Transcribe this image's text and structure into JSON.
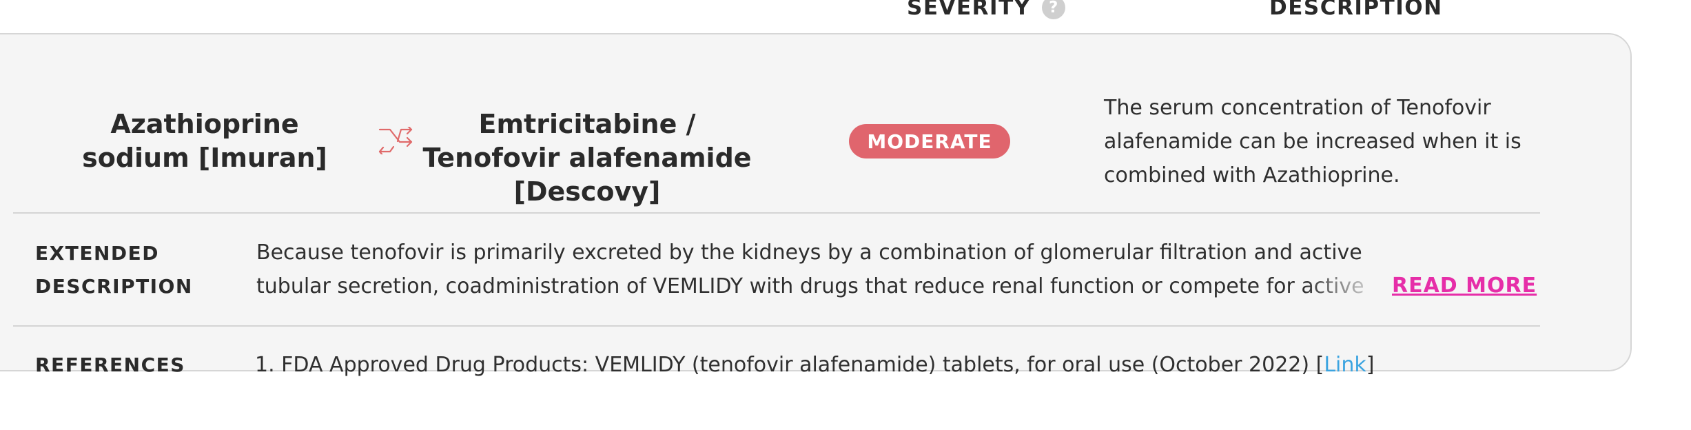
{
  "table_header": {
    "severity_label": "SEVERITY",
    "severity_help_icon": "?",
    "description_label": "DESCRIPTION"
  },
  "interaction": {
    "drug_a": "Azathioprine sodium [Imuran]",
    "swap_icon": "swap-arrows-icon",
    "drug_b": "Emtricitabine / Tenofovir alafenamide [Descovy]",
    "severity": "MODERATE",
    "description": "The serum concentration of Tenofovir alafenamide can be increased when it is combined with Azathioprine."
  },
  "extended_description": {
    "label": "EXTENDED DESCRIPTION",
    "text": "Because tenofovir is primarily excreted by the kidneys by a combination of glomerular filtration and active tubular secretion, coadministration of VEMLIDY with drugs that reduce renal function or compete for active tubular secretion may increase concentrations of tenofovir and other renally eliminated drugs.",
    "read_more_label": "READ MORE"
  },
  "references": {
    "label": "REFERENCES",
    "items": [
      {
        "text": "1. FDA Approved Drug Products: VEMLIDY (tenofovir alafenamide) tablets, for oral use (October 2022) [",
        "link_label": "Link",
        "suffix": "]"
      }
    ]
  },
  "colors": {
    "severity_badge": "#e0656d",
    "read_more": "#e62ea8",
    "link": "#3ba4e0",
    "swap_icon": "#e06a6a",
    "card_background": "#f5f5f5"
  }
}
